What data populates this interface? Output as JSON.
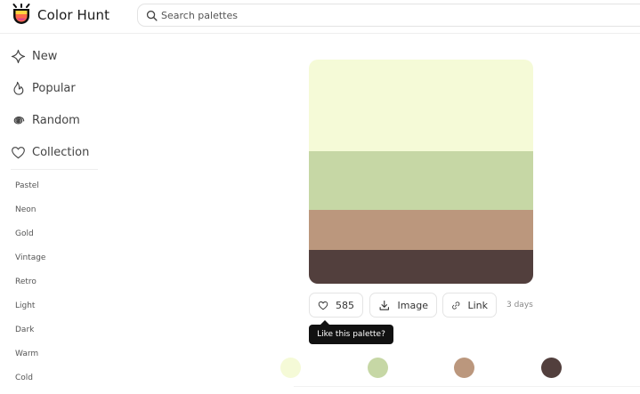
{
  "header": {
    "brand": "Color Hunt",
    "search_placeholder": "Search palettes"
  },
  "sidebar": {
    "nav": [
      {
        "label": "New",
        "icon": "sparkle-icon"
      },
      {
        "label": "Popular",
        "icon": "flame-icon"
      },
      {
        "label": "Random",
        "icon": "spiral-icon"
      },
      {
        "label": "Collection",
        "icon": "heart-icon"
      }
    ],
    "tags": [
      "Pastel",
      "Neon",
      "Gold",
      "Vintage",
      "Retro",
      "Light",
      "Dark",
      "Warm",
      "Cold"
    ]
  },
  "palette": {
    "colors": [
      "#f5fad7",
      "#c6d7a5",
      "#bb977d",
      "#523f3d"
    ]
  },
  "actions": {
    "likes": "585",
    "image_label": "Image",
    "link_label": "Link",
    "time": "3 days",
    "tooltip": "Like this palette?"
  },
  "next_palette": {
    "colors": [
      "#f5fad7",
      "#c6d7a5",
      "#bb977d",
      "#523f3d"
    ]
  }
}
